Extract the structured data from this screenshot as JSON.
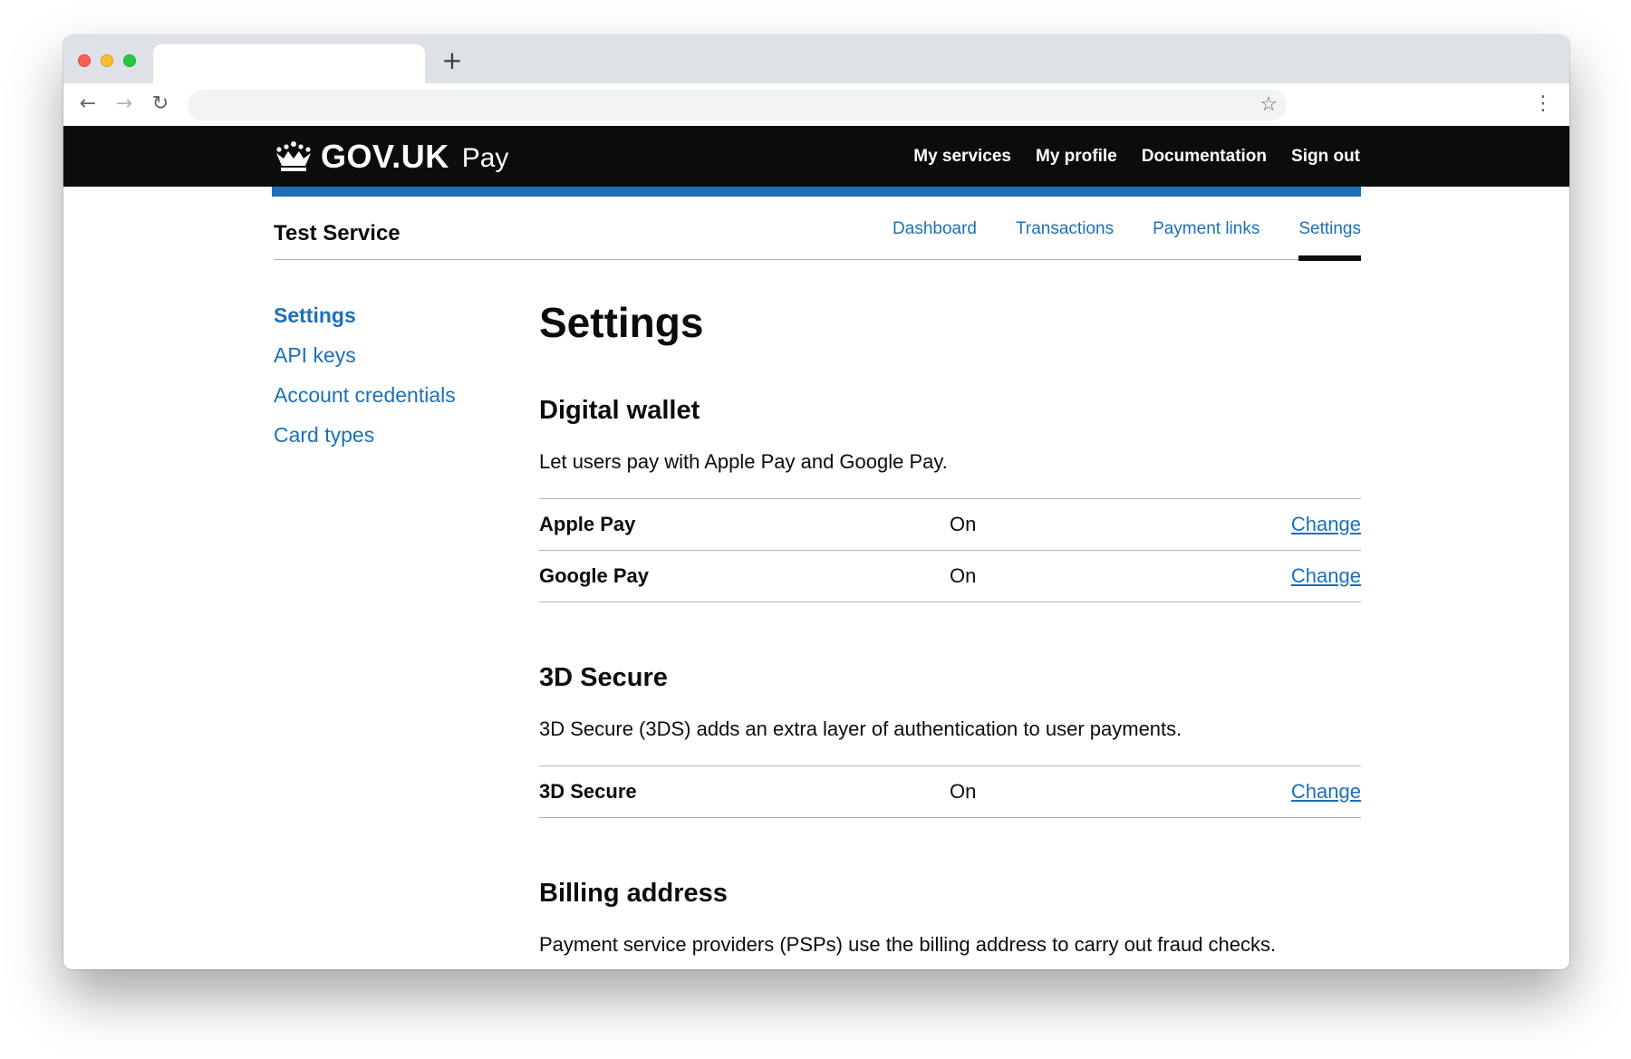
{
  "browser": {
    "new_tab_glyph": "+",
    "back_glyph": "←",
    "forward_glyph": "→",
    "reload_glyph": "↻",
    "star_glyph": "☆",
    "menu_glyph": "⋮"
  },
  "header": {
    "logo_text": "GOV.UK",
    "product_name": "Pay",
    "nav": [
      {
        "label": "My services"
      },
      {
        "label": "My profile"
      },
      {
        "label": "Documentation"
      },
      {
        "label": "Sign out"
      }
    ]
  },
  "service": {
    "name": "Test Service",
    "tabs": [
      {
        "label": "Dashboard"
      },
      {
        "label": "Transactions"
      },
      {
        "label": "Payment links"
      },
      {
        "label": "Settings"
      }
    ],
    "active_tab": "Settings"
  },
  "sidebar": {
    "items": [
      {
        "label": "Settings"
      },
      {
        "label": "API keys"
      },
      {
        "label": "Account credentials"
      },
      {
        "label": "Card types"
      }
    ]
  },
  "main": {
    "title": "Settings",
    "sections": [
      {
        "title": "Digital wallet",
        "description": "Let users pay with Apple Pay and Google Pay.",
        "rows": [
          {
            "key": "Apple Pay",
            "value": "On",
            "action": "Change"
          },
          {
            "key": "Google Pay",
            "value": "On",
            "action": "Change"
          }
        ]
      },
      {
        "title": "3D Secure",
        "description": "3D Secure (3DS) adds an extra layer of authentication to user payments.",
        "rows": [
          {
            "key": "3D Secure",
            "value": "On",
            "action": "Change"
          }
        ]
      },
      {
        "title": "Billing address",
        "description": "Payment service providers (PSPs) use the billing address to carry out fraud checks."
      }
    ]
  },
  "colors": {
    "header_bg": "#0b0c0c",
    "brand_blue": "#1d70b8",
    "link": "#1d70b8",
    "text": "#0b0c0c",
    "border": "#b1b4b6"
  }
}
